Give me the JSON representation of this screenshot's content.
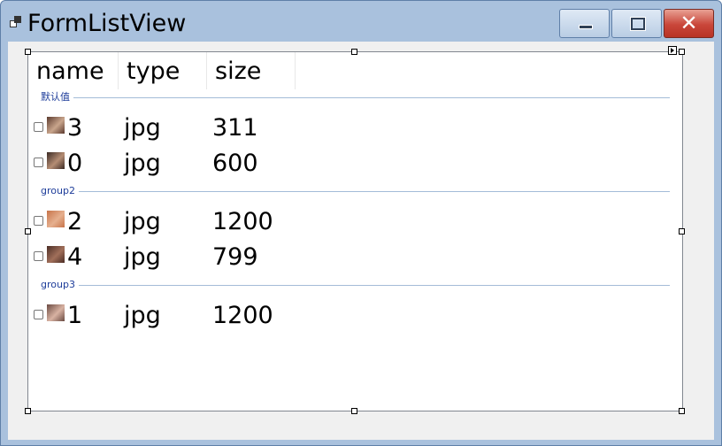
{
  "window": {
    "title": "FormListView"
  },
  "listview": {
    "columns": [
      {
        "label": "name"
      },
      {
        "label": "type"
      },
      {
        "label": "size"
      }
    ],
    "groups": [
      {
        "label": "默认值",
        "items": [
          {
            "name": "3",
            "type": "jpg",
            "size": "311",
            "thumb_colors": [
              "#5b3a2e",
              "#c9a58c"
            ]
          },
          {
            "name": "0",
            "type": "jpg",
            "size": "600",
            "thumb_colors": [
              "#3b2a24",
              "#b58d74"
            ]
          }
        ]
      },
      {
        "label": "group2",
        "items": [
          {
            "name": "2",
            "type": "jpg",
            "size": "1200",
            "thumb_colors": [
              "#c7744a",
              "#e6b08f"
            ]
          },
          {
            "name": "4",
            "type": "jpg",
            "size": "799",
            "thumb_colors": [
              "#4b2d25",
              "#a16f5a"
            ]
          }
        ]
      },
      {
        "label": "group3",
        "items": [
          {
            "name": "1",
            "type": "jpg",
            "size": "1200",
            "thumb_colors": [
              "#6a4a42",
              "#d8b2a2"
            ]
          }
        ]
      }
    ]
  },
  "colors": {
    "title_bar": "#a9c1dd",
    "close_button": "#c9463a",
    "group_text": "#1e3d9a",
    "group_line": "#a4bcd8"
  }
}
